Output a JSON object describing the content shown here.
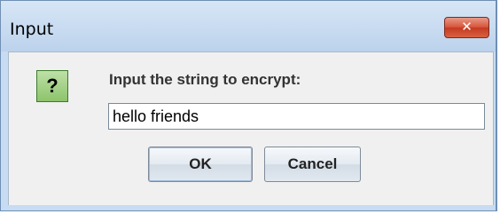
{
  "window": {
    "title": "Input"
  },
  "dialog": {
    "icon": "question-icon",
    "icon_glyph": "?",
    "prompt": "Input the string to encrypt:",
    "input_value": "hello friends"
  },
  "buttons": {
    "ok": "OK",
    "cancel": "Cancel"
  },
  "controls": {
    "close_glyph": "✕"
  },
  "colors": {
    "close_button": "#d04a2e",
    "question_icon": "#9fcd7d",
    "title_bar": "#c9dcf1"
  }
}
